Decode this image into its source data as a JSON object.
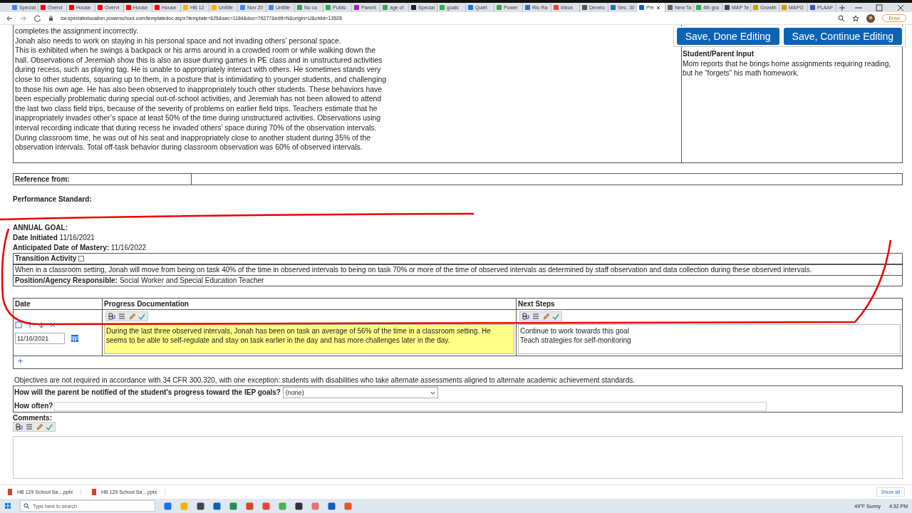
{
  "browser": {
    "tabs": [
      {
        "label": "Special",
        "selected": false,
        "color": "#4285f4"
      },
      {
        "label": "Overvi",
        "selected": false,
        "color": "#ff0000"
      },
      {
        "label": "House",
        "selected": false,
        "color": "#ff0000"
      },
      {
        "label": "Overvi",
        "selected": false,
        "color": "#ff0000"
      },
      {
        "label": "House",
        "selected": false,
        "color": "#ff0000"
      },
      {
        "label": "House",
        "selected": false,
        "color": "#ff0000"
      },
      {
        "label": "HB 12",
        "selected": false,
        "color": "#f4b400"
      },
      {
        "label": "Untitle",
        "selected": false,
        "color": "#f4b400"
      },
      {
        "label": "Nov 20",
        "selected": false,
        "color": "#4285f4"
      },
      {
        "label": "Untitle",
        "selected": false,
        "color": "#4285f4"
      },
      {
        "label": "No co",
        "selected": false,
        "color": "#34a853"
      },
      {
        "label": "Public",
        "selected": false,
        "color": "#34a853"
      },
      {
        "label": "Parent",
        "selected": false,
        "color": "#9c27b0"
      },
      {
        "label": "age of",
        "selected": false,
        "color": "#34a853"
      },
      {
        "label": "Special",
        "selected": false,
        "color": "#222222"
      },
      {
        "label": "goals",
        "selected": false,
        "color": "#34a853"
      },
      {
        "label": "Quiet",
        "selected": false,
        "color": "#1a73e8"
      },
      {
        "label": "Power",
        "selected": false,
        "color": "#34a853"
      },
      {
        "label": "Rio Ra",
        "selected": false,
        "color": "#3367d6"
      },
      {
        "label": "Inbox",
        "selected": false,
        "color": "#ea4335"
      },
      {
        "label": "Develo",
        "selected": false,
        "color": "#555555"
      },
      {
        "label": "Sec. 30",
        "selected": false,
        "color": "#21759b"
      },
      {
        "label": "Pre",
        "selected": true,
        "color": "#0066cc"
      },
      {
        "label": "New Ta",
        "selected": false,
        "color": "#5f6368"
      },
      {
        "label": "4th gra",
        "selected": false,
        "color": "#34a853"
      },
      {
        "label": "MAP Te",
        "selected": false,
        "color": "#444444"
      },
      {
        "label": "Growth",
        "selected": false,
        "color": "#c9a100"
      },
      {
        "label": "MAPG",
        "selected": false,
        "color": "#c9a100"
      },
      {
        "label": "PLAAF",
        "selected": false,
        "color": "#3f51b5"
      }
    ],
    "url": "sw.specialeducation.powerschool.com/templatedoc.aspx?template=626&sec=1184&doc=76277&edit=N&origin=U&child=13528",
    "profile_status": "Error"
  },
  "page": {
    "present_levels": [
      "completes the assignment incorrectly.",
      "Jonah also needs to work on staying in his personal space and not invading others’ personal space.",
      "This is exhibited when he swings a backpack or his arms around in a crowded room or while walking down the hall. Observations of Jeremiah show this is also an issue during games in PE class and in unstructured activities during recess, such as playing tag. He is unable to appropriately interact with others. He sometimes stands very close to other students, squaring up to them, in a posture that is intimidating to younger students, and challenging to those his own age. He has also been observed to inappropriately touch other students. These behaviors have been especially problematic during special out-of-school activities, and Jeremiah has not been allowed to attend the last two class field trips, because of the severity of problems on earlier field trips. Teachers estimate that he inappropriately invades other’s space at least 50% of the time during unstructured activities. Observations using interval recording indicate that during recess he invaded others’ space during 70% of the observation intervals. During classroom time, he was out of his seat and inappropriately close to another student during 35% of the observation intervals. Total off-task behavior during classroom observation was 60% of observed intervals."
    ],
    "student_parent_input": {
      "heading": "Student/Parent Input",
      "text": "Mom reports that he brings home assignments requiring reading, but he “forgets” his math homework."
    },
    "action_buttons": [
      "Save, Done Editing",
      "Save, Continue Editing"
    ],
    "reference_from_label": "Reference from:",
    "performance_standard_label": "Performance Standard:",
    "annual_goal": {
      "heading": "ANNUAL GOAL:",
      "date_initiated_label": "Date Initiated",
      "date_initiated": "11/16/2021",
      "mastery_label": "Anticipated Date of Mastery:",
      "mastery_date": "11/16/2022",
      "transition_label": "Transition Activity",
      "transition_checked": false,
      "goal_text": "When in a classroom setting, Jonah will move from being on task 40% of the time in observed intervals to being on task 70% or more of the time of observed intervals as determined by staff observation and data collection during these observed intervals.",
      "responsible_label": "Position/Agency Responsible:",
      "responsible": "Social Worker and Special Education Teacher"
    },
    "progress_table": {
      "columns": [
        "Date",
        "Progress Documentation",
        "Next Steps"
      ],
      "rows": [
        {
          "date": "11/16/2021",
          "progress": "During the last three observed intervals, Jonah has been on task an average of 56% of the time in a classroom setting.  He seems to be able to self-regulate and stay on task earlier in the day and has more challenges later in the day.",
          "next_steps": [
            "Continue to work towards this goal",
            "Teach strategies for self-monitoring"
          ]
        }
      ],
      "add_label": "+"
    },
    "objectives_note": "Objectives are not required in accordance with 34 CFR 300.320, with one exception: students with disabilities who take alternate assessments aligned to alternate academic achievement standards.",
    "notification": {
      "question": "How will the parent be notified of the student's progress toward the IEP goals?",
      "select_value": "(none)",
      "how_often_label": "How often?"
    },
    "comments_label": "Comments:"
  },
  "downloads": {
    "items": [
      "HB 129 School Sa....pptx",
      "HB 129 School Sa....pptx"
    ],
    "show_all": "Show all"
  },
  "taskbar": {
    "search_placeholder": "Type here to search",
    "weather": "49°F  Sunny",
    "time": "4:32 PM"
  }
}
